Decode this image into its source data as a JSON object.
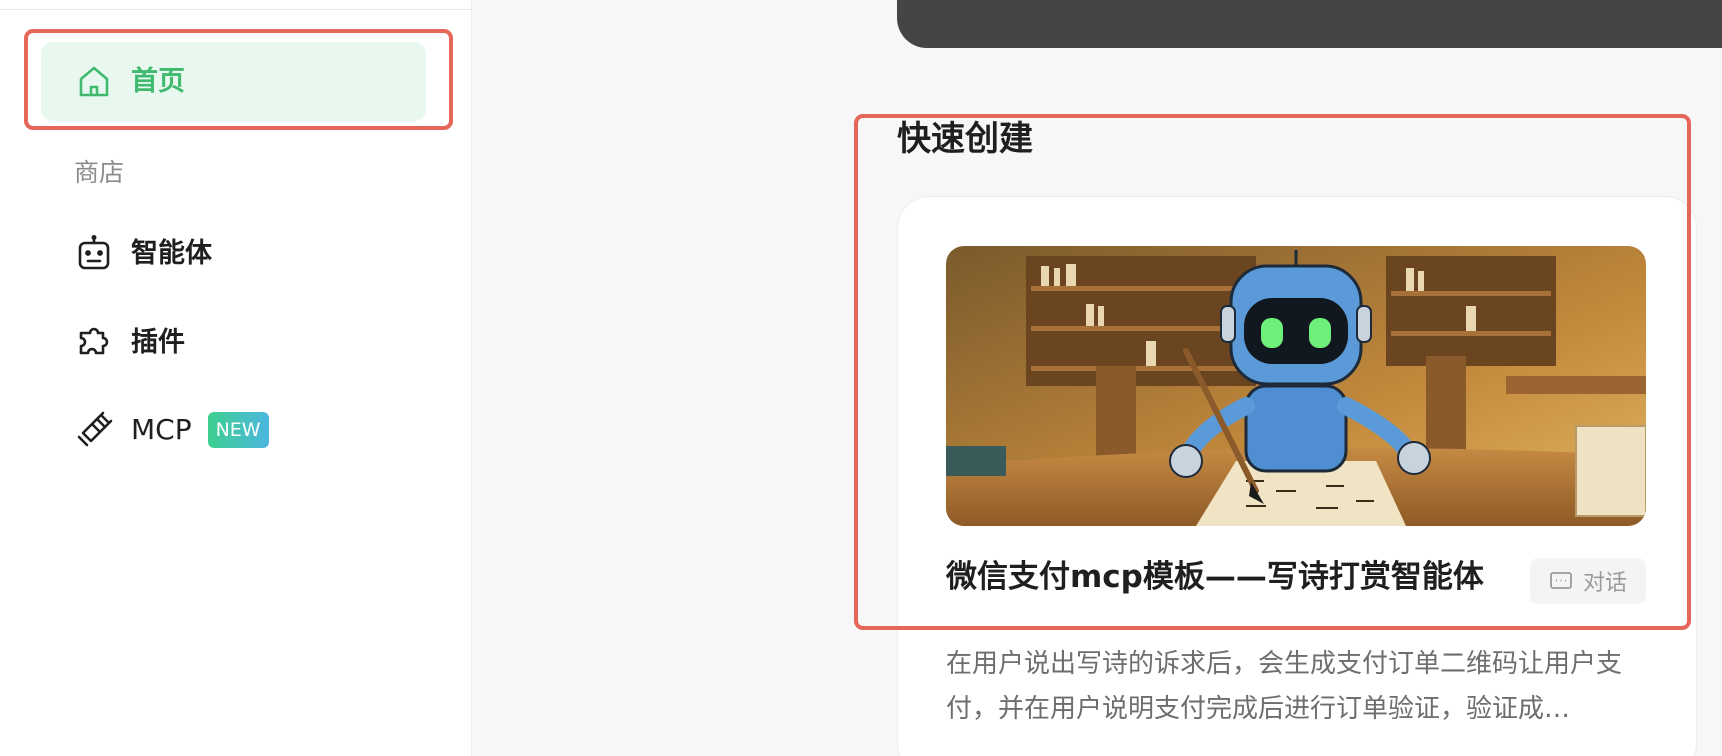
{
  "sidebar": {
    "home_label": "首页",
    "section_store": "商店",
    "items": [
      {
        "label": "智能体",
        "icon": "robot-icon"
      },
      {
        "label": "插件",
        "icon": "puzzle-icon"
      },
      {
        "label": "MCP",
        "icon": "link-icon",
        "badge": "NEW"
      }
    ]
  },
  "main": {
    "section_title": "快速创建",
    "card": {
      "title": "微信支付mcp模板——写诗打赏智能体",
      "action_label": "对话",
      "description": "在用户说出写诗的诉求后，会生成支付订单二维码让用户支付，并在用户说明支付完成后进行订单验证，验证成…",
      "image_alt": "robot writing with a brush in a library"
    }
  },
  "colors": {
    "accent_green": "#3fba6f",
    "highlight_red": "#e5675a",
    "home_bg": "#e9f8ef",
    "banner_dark": "#454545"
  }
}
